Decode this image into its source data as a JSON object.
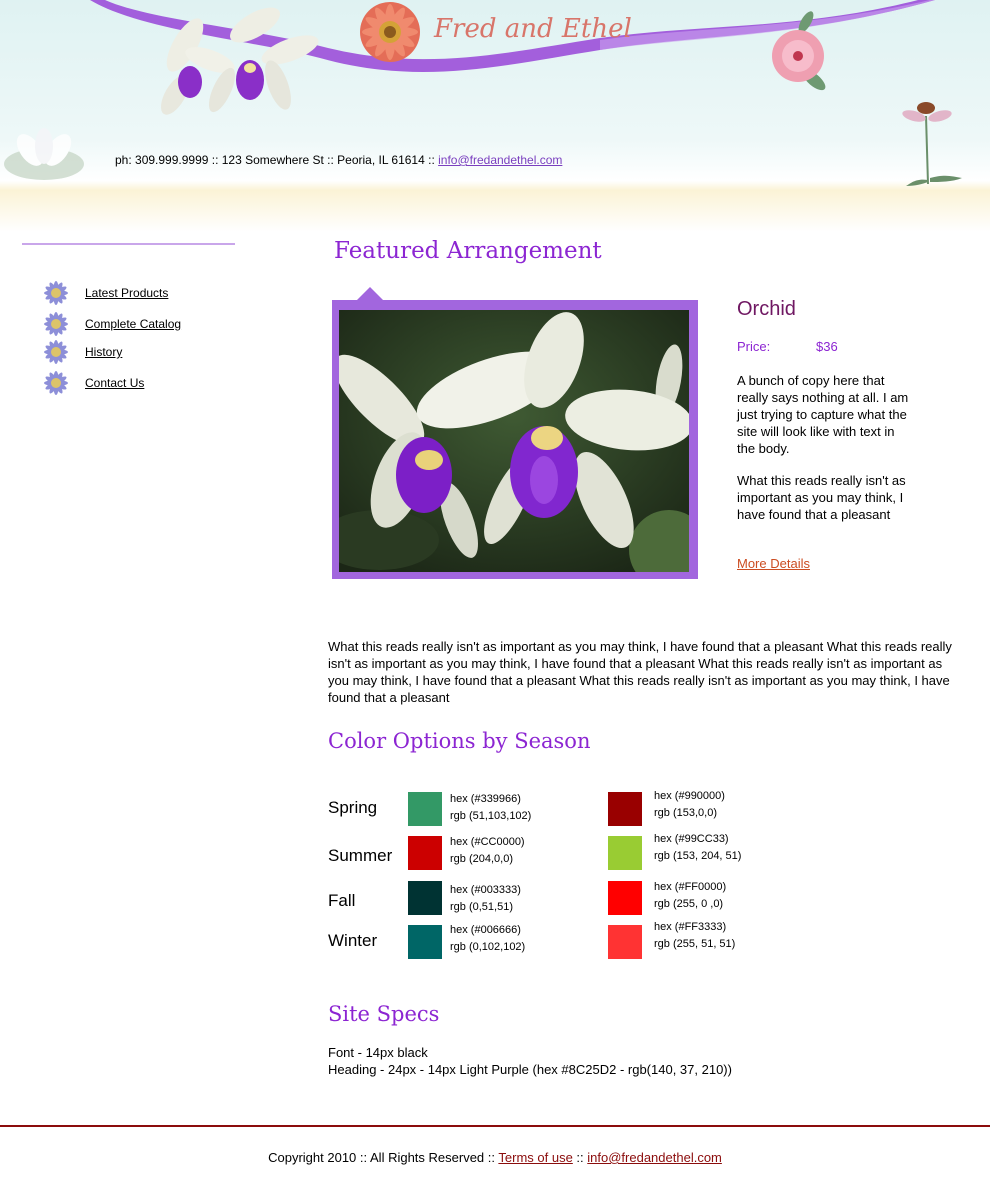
{
  "header": {
    "logo_text": "Fred and Ethel",
    "contact_text": "ph: 309.999.9999 :: 123 Somewhere St :: Peoria, IL 61614 :: ",
    "contact_email": "info@fredandethel.com"
  },
  "sidebar": {
    "items": [
      {
        "label": "Latest Products"
      },
      {
        "label": "Complete Catalog"
      },
      {
        "label": "History"
      },
      {
        "label": "Contact Us"
      }
    ]
  },
  "featured": {
    "heading": "Featured Arrangement",
    "product_name": "Orchid",
    "price_label": "Price:",
    "price_value": "$36",
    "description_1": "A bunch of copy here that really says nothing at all. I am just trying to capture what the site will look like with text in the body.",
    "description_2": "What this reads really isn't as important as you may think, I have found that a pleasant",
    "more_details": "More Details"
  },
  "body_text": "What this reads really isn't as important as you may think, I have found that a pleasant What this reads really isn't as important as you may think, I have found that a pleasant What this reads really isn't as important as you may think, I have found that a pleasant What this reads really isn't as important as you may think, I have found that a pleasant",
  "color_options": {
    "heading": "Color Options by Season",
    "seasons": [
      {
        "name": "Spring",
        "c1": {
          "hex": "hex (#339966)",
          "rgb": "rgb (51,103,102)",
          "color": "#339966"
        },
        "c2": {
          "hex": "hex (#990000)",
          "rgb": "rgb (153,0,0)",
          "color": "#990000"
        }
      },
      {
        "name": "Summer",
        "c1": {
          "hex": "hex (#CC0000)",
          "rgb": "rgb (204,0,0)",
          "color": "#CC0000"
        },
        "c2": {
          "hex": "hex (#99CC33)",
          "rgb": "rgb (153, 204, 51)",
          "color": "#99CC33"
        }
      },
      {
        "name": "Fall",
        "c1": {
          "hex": "hex (#003333)",
          "rgb": "rgb (0,51,51)",
          "color": "#003333"
        },
        "c2": {
          "hex": "hex (#FF0000)",
          "rgb": "rgb (255, 0 ,0)",
          "color": "#FF0000"
        }
      },
      {
        "name": "Winter",
        "c1": {
          "hex": "hex (#006666)",
          "rgb": "rgb (0,102,102)",
          "color": "#006666"
        },
        "c2": {
          "hex": "hex (#FF3333)",
          "rgb": "rgb (255, 51, 51)",
          "color": "#FF3333"
        }
      }
    ]
  },
  "site_specs": {
    "heading": "Site Specs",
    "line1": "Font - 14px black",
    "line2": "Heading - 24px - 14px Light Purple (hex #8C25D2 - rgb(140, 37, 210))"
  },
  "footer": {
    "copyright": "Copyright 2010 :: All Rights Reserved :: ",
    "terms": "Terms of use",
    "separator": " :: ",
    "email": "info@fredandethel.com"
  },
  "colors": {
    "accent_purple": "#8C25D2",
    "frame_purple": "#a266de",
    "product_name": "#6f1762",
    "link_orange": "#cc4d22",
    "footer_red": "#8b0c0c"
  },
  "icons": {
    "nav_bullet": "aster-flower-icon",
    "logo": "gerbera-daisy-icon"
  }
}
